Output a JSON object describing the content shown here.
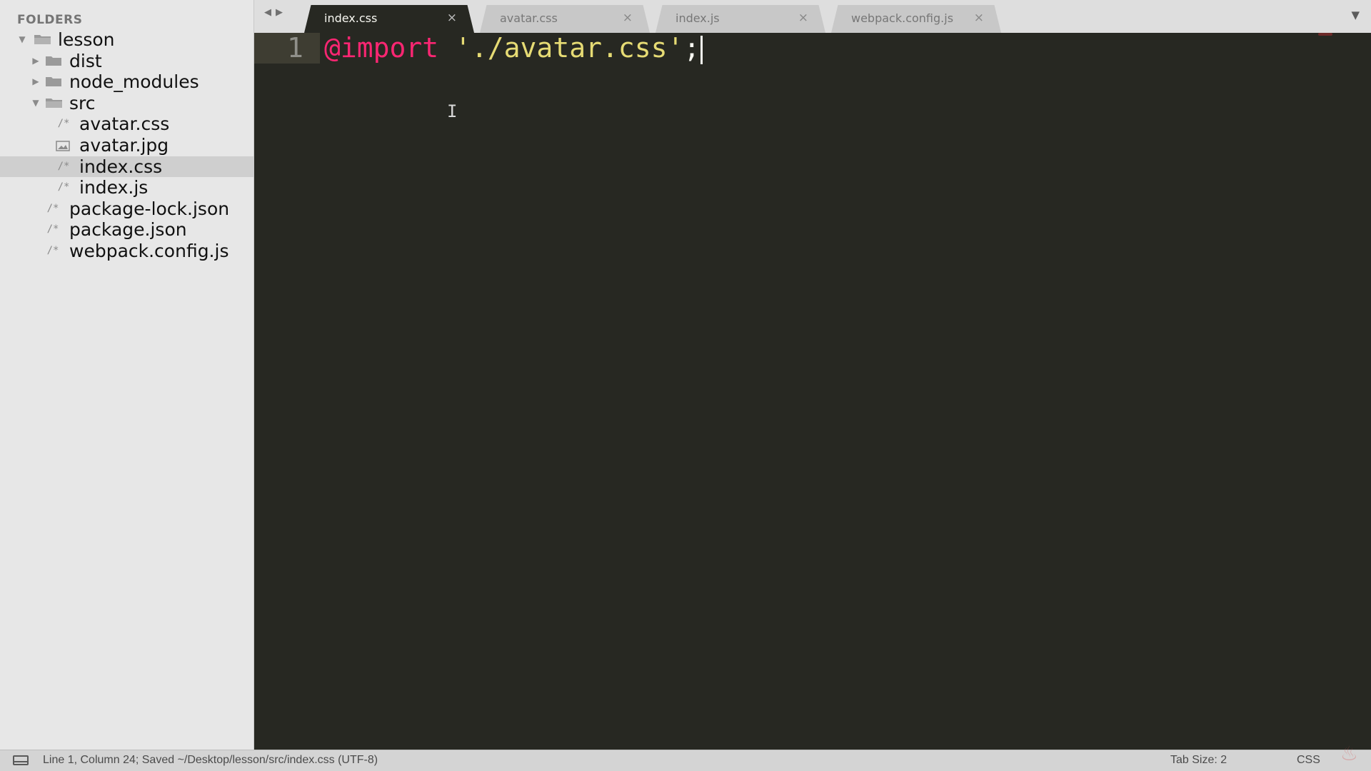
{
  "sidebar": {
    "header": "FOLDERS",
    "items": [
      {
        "label": "lesson",
        "kind": "folder",
        "expanded": true,
        "depth": 0
      },
      {
        "label": "dist",
        "kind": "folder",
        "expanded": false,
        "depth": 1
      },
      {
        "label": "node_modules",
        "kind": "folder",
        "expanded": false,
        "depth": 1
      },
      {
        "label": "src",
        "kind": "folder",
        "expanded": true,
        "depth": 1
      },
      {
        "label": "avatar.css",
        "kind": "file",
        "depth": 2
      },
      {
        "label": "avatar.jpg",
        "kind": "image",
        "depth": 2
      },
      {
        "label": "index.css",
        "kind": "file",
        "depth": 2,
        "selected": true
      },
      {
        "label": "index.js",
        "kind": "file",
        "depth": 2
      },
      {
        "label": "package-lock.json",
        "kind": "file",
        "depth": 1
      },
      {
        "label": "package.json",
        "kind": "file",
        "depth": 1
      },
      {
        "label": "webpack.config.js",
        "kind": "file",
        "depth": 1
      }
    ],
    "icons": {
      "folder_open": "folder-open-icon",
      "folder_closed": "folder-icon",
      "file": "file-code-icon",
      "image": "image-file-icon",
      "expanded": "chevron-down-icon",
      "collapsed": "chevron-right-icon"
    }
  },
  "tabs": [
    {
      "label": "index.css",
      "active": true
    },
    {
      "label": "avatar.css",
      "active": false
    },
    {
      "label": "index.js",
      "active": false
    },
    {
      "label": "webpack.config.js",
      "active": false
    }
  ],
  "editor": {
    "line_number": "1",
    "code": {
      "keyword": "@import",
      "space": " ",
      "string": "'./avatar.css'",
      "punctuation": ";"
    }
  },
  "statusbar": {
    "position": "Line 1, Column 24; Saved ~/Desktop/lesson/src/index.css (UTF-8)",
    "tab_size": "Tab Size: 2",
    "syntax": "CSS"
  },
  "colors": {
    "editor_bg": "#272822",
    "keyword": "#f92672",
    "string": "#e6db74",
    "text": "#f8f8f2",
    "sidebar_bg": "#e7e7e7"
  }
}
